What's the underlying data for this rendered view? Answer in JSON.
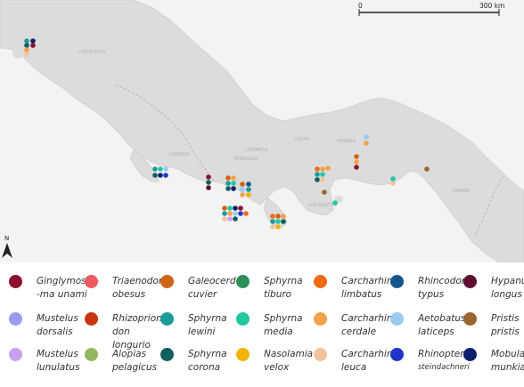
{
  "map": {
    "scale_bar": {
      "start_label": "0",
      "end_label": "300 km"
    },
    "north_arrow_label": "N",
    "place_labels": [
      "COSTA RICA",
      "PANAMA",
      "GOLFO",
      "DARIEN",
      "COMARCA",
      "LOS SANTOS",
      "VERAGUAS",
      "CHIRIQUI"
    ],
    "colors": {
      "sea": "#f3f3f3",
      "land": "#dcdcdc",
      "border": "#c2c2c2"
    }
  },
  "legend": {
    "items": [
      {
        "line1": "Ginglymosto-",
        "line2": "-ma unami",
        "color": "#8b1030",
        "small": false
      },
      {
        "line1": "Mustelus",
        "line2": "dorsalis",
        "color": "#9b9bef",
        "small": false
      },
      {
        "line1": "Mustelus",
        "line2": "lunulatus",
        "color": "#c9a1ef",
        "small": false
      },
      {
        "line1": "Triaenodon",
        "line2": "obesus",
        "color": "#f05a60",
        "small": false
      },
      {
        "line1": "Rhizopriono-",
        "line2": "don",
        "line3": "longurio",
        "color": "#c8350d",
        "small": false
      },
      {
        "line1": "Alopias",
        "line2": "pelagicus",
        "color": "#93b75c",
        "small": false
      },
      {
        "line1": "Galeocerdo",
        "line2": "cuvier",
        "color": "#cf6414",
        "small": false
      },
      {
        "line1": "Sphyrna",
        "line2": "lewini",
        "color": "#1a9c9a",
        "small": false
      },
      {
        "line1": "Sphyrna",
        "line2": "corona",
        "color": "#125f60",
        "small": false
      },
      {
        "line1": "Sphyrna",
        "line2": "tiburo",
        "color": "#2e8f5a",
        "small": false
      },
      {
        "line1": "Sphyrna",
        "line2": "media",
        "color": "#23c7a0",
        "small": false
      },
      {
        "line1": "Nasolamia",
        "line2": "velox",
        "color": "#f2b40a",
        "small": false
      },
      {
        "line1": "Carcharhinus",
        "line2": "limbatus",
        "color": "#f26b12",
        "small": true
      },
      {
        "line1": "Carcharhinus",
        "line2": "cerdale",
        "color": "#f5a04a",
        "small": true
      },
      {
        "line1": "Carcharhinus",
        "line2": "leuca",
        "color": "#f3c39a",
        "small": true
      },
      {
        "line1": "Rhincodon",
        "line2": "typus",
        "color": "#14568c",
        "small": false
      },
      {
        "line1": "Aetobatus",
        "line2": "laticeps",
        "color": "#9bcaf5",
        "small": false
      },
      {
        "line1": "Rhinoptera",
        "line2": "steindachneri",
        "color": "#1f36c8",
        "small": true,
        "small_second": true
      },
      {
        "line1": "Hypanus",
        "line2": "longus",
        "color": "#5e0f32",
        "small": false
      },
      {
        "line1": "Pristis",
        "line2": "pristis",
        "color": "#9a6530",
        "small": false
      },
      {
        "line1": "Mobula",
        "line2": "munkiana",
        "color": "#0e1f6e",
        "small": false
      }
    ]
  }
}
